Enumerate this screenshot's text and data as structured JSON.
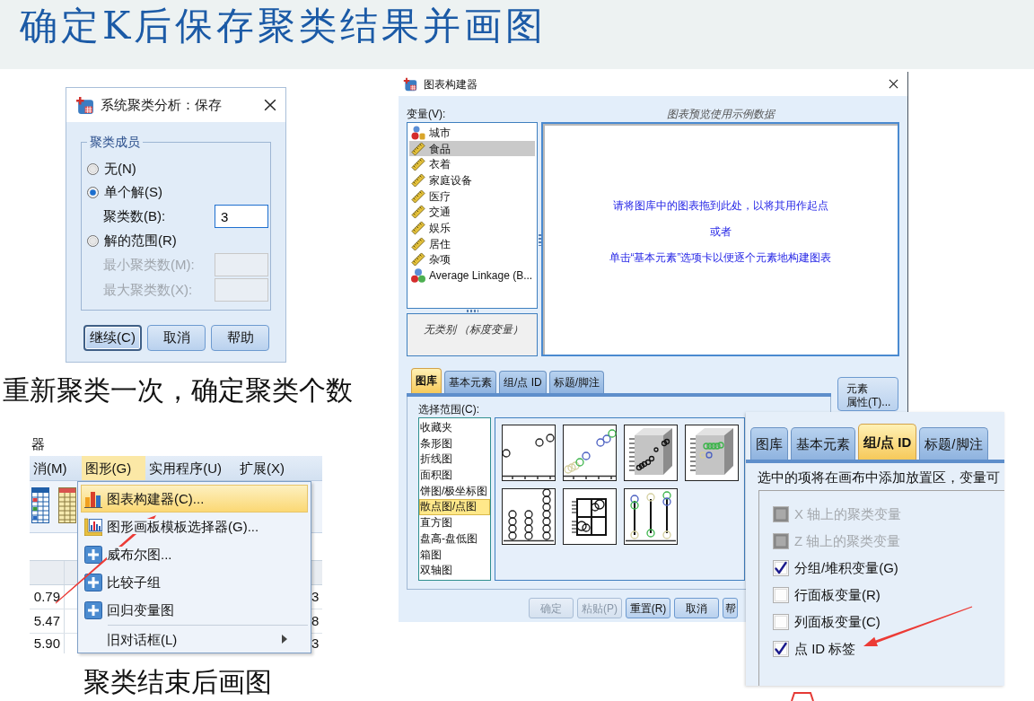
{
  "slide_title": "确定K后保存聚类结果并画图",
  "save_dialog": {
    "title": "系统聚类分析：保存",
    "group_title": "聚类成员",
    "options": [
      {
        "label": "无(N)",
        "selected": false
      },
      {
        "label": "单个解(S)",
        "selected": true,
        "fields": [
          {
            "label": "聚类数(B):",
            "value": "3",
            "disabled": false
          }
        ]
      },
      {
        "label": "解的范围(R)",
        "selected": false,
        "fields": [
          {
            "label": "最小聚类数(M):",
            "disabled": true
          },
          {
            "label": "最大聚类数(X):",
            "disabled": true
          }
        ]
      }
    ],
    "buttons": [
      {
        "label": "继续(C)",
        "focused": true
      },
      {
        "label": "取消",
        "focused": false
      },
      {
        "label": "帮助",
        "focused": false
      }
    ]
  },
  "save_caption": "重新聚类一次，确定聚类个数",
  "menu_screenshot": {
    "title_fragment": "器",
    "menubar": [
      {
        "label": "消(M)",
        "selected": false
      },
      {
        "label": "图形(G)",
        "selected": true
      },
      {
        "label": "实用程序(U)",
        "selected": false
      },
      {
        "label": "扩展(X)",
        "selected": false
      }
    ],
    "rows": [
      [
        "0.79",
        "3"
      ],
      [
        "5.47",
        "8"
      ],
      [
        "5.90",
        "3"
      ]
    ],
    "menu_items": [
      {
        "kind": "chart",
        "label": "图表构建器(C)...",
        "selected": true
      },
      {
        "kind": "template",
        "label": "图形画板模板选择器(G)...",
        "selected": false
      },
      {
        "kind": "plus",
        "label": "威布尔图...",
        "selected": false
      },
      {
        "kind": "plus",
        "label": "比较子组",
        "selected": false
      },
      {
        "kind": "plus",
        "label": "回归变量图",
        "selected": false
      },
      {
        "kind": "submenu",
        "label": "旧对话框(L)",
        "selected": false
      }
    ]
  },
  "menu_caption": "聚类结束后画图",
  "chart_builder": {
    "title": "图表构建器",
    "variables_label": "变量(V):",
    "variables": [
      {
        "kind": "nominal",
        "label": "城市",
        "selected": false
      },
      {
        "kind": "scale",
        "label": "食品",
        "selected": true
      },
      {
        "kind": "scale",
        "label": "衣着",
        "selected": false
      },
      {
        "kind": "scale",
        "label": "家庭设备",
        "selected": false
      },
      {
        "kind": "scale",
        "label": "医疗",
        "selected": false
      },
      {
        "kind": "scale",
        "label": "交通",
        "selected": false
      },
      {
        "kind": "scale",
        "label": "娱乐",
        "selected": false
      },
      {
        "kind": "scale",
        "label": "居住",
        "selected": false
      },
      {
        "kind": "scale",
        "label": "杂项",
        "selected": false
      },
      {
        "kind": "cluster",
        "label": "Average Linkage (B...",
        "selected": false
      }
    ],
    "category_note": "无类别 （标度变量）",
    "preview_caption": "图表预览使用示例数据",
    "canvas_lines": [
      "请将图库中的图表拖到此处，以将其用作起点",
      "或者",
      "单击“基本元素”选项卡以便逐个元素地构建图表"
    ],
    "tabs": [
      {
        "label": "图库",
        "selected": true
      },
      {
        "label": "基本元素",
        "selected": false
      },
      {
        "label": "组/点 ID",
        "selected": false
      },
      {
        "label": "标题/脚注",
        "selected": false
      }
    ],
    "element_properties_button": "元素属性(T)...",
    "gallery_label": "选择范围(C):",
    "gallery_categories": [
      {
        "label": "收藏夹",
        "selected": false
      },
      {
        "label": "条形图",
        "selected": false
      },
      {
        "label": "折线图",
        "selected": false
      },
      {
        "label": "面积图",
        "selected": false
      },
      {
        "label": "饼图/极坐标图",
        "selected": false
      },
      {
        "label": "散点图/点图",
        "selected": true
      },
      {
        "label": "直方图",
        "selected": false
      },
      {
        "label": "盘高-盘低图",
        "selected": false
      },
      {
        "label": "箱图",
        "selected": false
      },
      {
        "label": "双轴图",
        "selected": false
      }
    ],
    "buttons": [
      {
        "label": "确定",
        "disabled": true
      },
      {
        "label": "粘贴(P)",
        "disabled": true
      },
      {
        "label": "重置(R)",
        "disabled": false
      },
      {
        "label": "取消",
        "disabled": false
      },
      {
        "label": "帮",
        "disabled": false
      }
    ]
  },
  "group_panel": {
    "tabs": [
      {
        "label": "图库",
        "selected": false
      },
      {
        "label": "基本元素",
        "selected": false
      },
      {
        "label": "组/点 ID",
        "selected": true
      },
      {
        "label": "标题/脚注",
        "selected": false
      }
    ],
    "description": "选中的项将在画布中添加放置区，变量可",
    "options": [
      {
        "label": "X 轴上的聚类变量",
        "checked": false,
        "disabled": true
      },
      {
        "label": "Z 轴上的聚类变量",
        "checked": false,
        "disabled": true
      },
      {
        "label": "分组/堆积变量(G)",
        "checked": true,
        "disabled": false
      },
      {
        "label": "行面板变量(R)",
        "checked": false,
        "disabled": false
      },
      {
        "label": "列面板变量(C)",
        "checked": false,
        "disabled": false
      },
      {
        "label": "点 ID 标签",
        "checked": true,
        "disabled": false
      }
    ]
  }
}
